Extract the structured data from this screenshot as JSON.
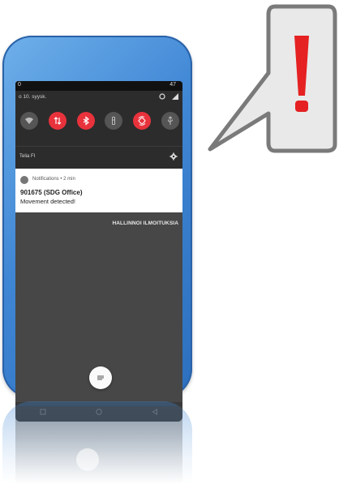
{
  "status_bar": {
    "time": "0",
    "battery": "47"
  },
  "quick_settings": {
    "date": "o 10. syysk.",
    "tiles": [
      {
        "name": "wifi-icon",
        "on": false
      },
      {
        "name": "mobile-data-icon",
        "on": true
      },
      {
        "name": "bluetooth-icon",
        "on": true
      },
      {
        "name": "flashlight-icon",
        "on": false
      },
      {
        "name": "auto-rotate-icon",
        "on": true
      },
      {
        "name": "usb-icon",
        "on": false
      }
    ],
    "operator": "Telia FI"
  },
  "notification": {
    "app_line": "Notifications • 2 min",
    "title": "901675 (SDG Office)",
    "text": "Movement detected!"
  },
  "manage_label": "HALLINNOI ILMOITUKSIA",
  "callout": {
    "symbol": "!"
  },
  "colors": {
    "accent_red": "#e8323c",
    "phone_blue": "#3f86d4",
    "shade_dark": "#2c2c2c",
    "callout_red": "#e52122"
  }
}
